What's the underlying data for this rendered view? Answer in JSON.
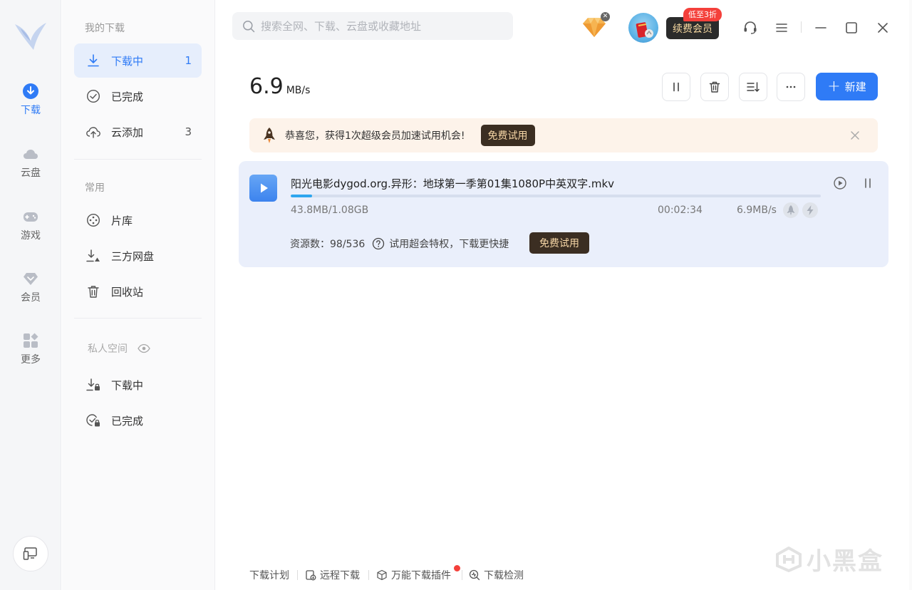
{
  "rail": {
    "items": [
      {
        "label": "下载",
        "icon": "download-circle-icon",
        "active": true
      },
      {
        "label": "云盘",
        "icon": "cloud-icon"
      },
      {
        "label": "游戏",
        "icon": "gamepad-icon"
      },
      {
        "label": "会员",
        "icon": "diamond-icon"
      },
      {
        "label": "更多",
        "icon": "grid-icon"
      }
    ],
    "bottom_icon": "device-icon"
  },
  "nav": {
    "my_downloads_title": "我的下载",
    "downloading": {
      "label": "下载中",
      "count": "1"
    },
    "completed": {
      "label": "已完成"
    },
    "cloud_added": {
      "label": "云添加",
      "count": "3"
    },
    "common_title": "常用",
    "library": {
      "label": "片库"
    },
    "third_party": {
      "label": "三方网盘"
    },
    "recycle": {
      "label": "回收站"
    },
    "private_title": "私人空间",
    "private_downloading": {
      "label": "下载中"
    },
    "private_completed": {
      "label": "已完成"
    }
  },
  "topbar": {
    "search_placeholder": "搜索全网、下载、云盘或收藏地址",
    "renew_label": "续费会员",
    "renew_badge": "低至3折"
  },
  "speed": {
    "value": "6.9",
    "unit": "MB/s"
  },
  "toolbar": {
    "new_label": "新建"
  },
  "promo": {
    "text": "恭喜您，获得1次超级会员加速试用机会!",
    "button": "免费试用"
  },
  "task": {
    "name": "阳光电影dygod.org.异形：地球第一季第01集1080P中英双字.mkv",
    "size": "43.8MB/1.08GB",
    "remaining": "00:02:34",
    "rate": "6.9MB/s",
    "progress": 0.04,
    "sources_label": "资源数：98/536",
    "hint": "试用超会特权，下载更快捷",
    "button": "免费试用"
  },
  "footer": {
    "plan": "下载计划",
    "remote": "远程下载",
    "plugin": "万能下载插件",
    "check": "下载检测"
  },
  "watermark": "小黑盒",
  "colors": {
    "accent": "#2f7bf6",
    "active_bg": "#e6eefc",
    "promo_bg": "#fdf3ea",
    "dark_button": "#3b2e22",
    "progress": "#2ea6ef",
    "badge_red": "#f4403b"
  }
}
